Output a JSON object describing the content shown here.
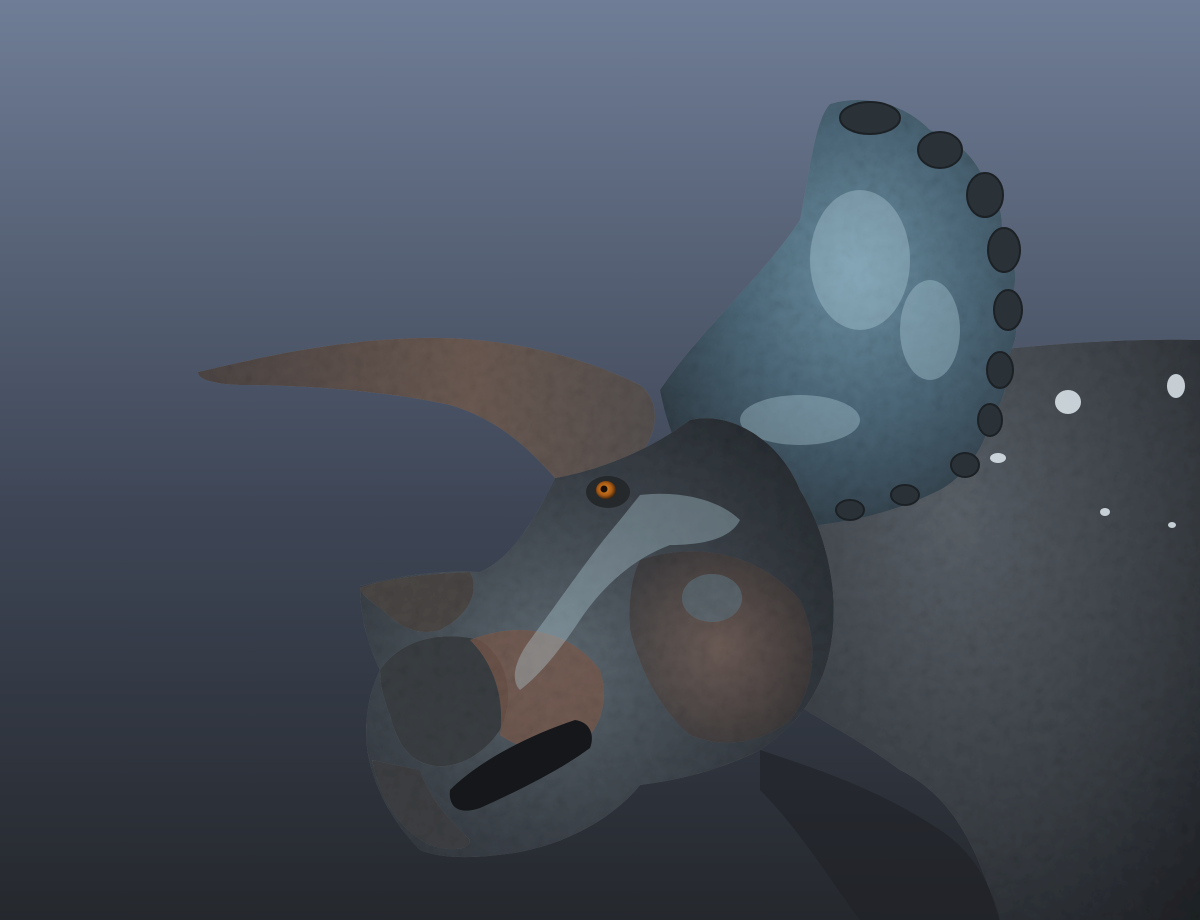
{
  "scene": {
    "subject": "triceratops-head-3d-render",
    "background": {
      "top_color": "#6f7d96",
      "bottom_color": "#25282d"
    },
    "palette": {
      "skin_dark": "#2f3338",
      "skin_mid": "#4a525a",
      "frill_blue": "#5d7f92",
      "frill_highlight": "#b6d4e0",
      "horn_brown": "#6b5a52",
      "horn_tip": "#8a7a70",
      "snout_brown": "#7a5a4c",
      "eye_orange": "#c0701e",
      "mouth_dark": "#15171a",
      "spot_white": "#dfe9ee"
    }
  }
}
